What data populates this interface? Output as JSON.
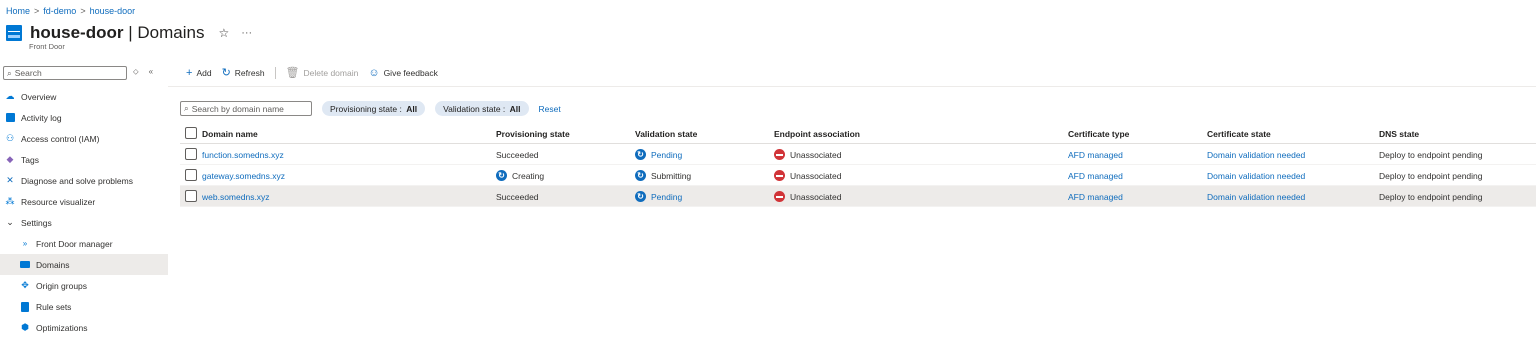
{
  "breadcrumb": [
    "Home",
    "fd-demo",
    "house-door"
  ],
  "header": {
    "resource": "house-door",
    "separator": " | ",
    "blade": "Domains",
    "subtitle": "Front Door"
  },
  "sidebar": {
    "search_placeholder": "Search",
    "items": [
      {
        "label": "Overview",
        "icon": "cloud-icon",
        "color": "#0078d4"
      },
      {
        "label": "Activity log",
        "icon": "log-icon",
        "color": "#0078d4"
      },
      {
        "label": "Access control (IAM)",
        "icon": "people-icon",
        "color": "#0078d4"
      },
      {
        "label": "Tags",
        "icon": "tag-icon",
        "color": "#8764b8"
      },
      {
        "label": "Diagnose and solve problems",
        "icon": "wrench-icon",
        "color": "#0078d4"
      },
      {
        "label": "Resource visualizer",
        "icon": "nodes-icon",
        "color": "#0078d4"
      },
      {
        "label": "Settings",
        "icon": "chevron-down-icon",
        "color": "#323130"
      },
      {
        "label": "Front Door manager",
        "icon": "front-door-icon",
        "color": "#0078d4"
      },
      {
        "label": "Domains",
        "icon": "domains-icon",
        "color": "#0078d4"
      },
      {
        "label": "Origin groups",
        "icon": "origin-icon",
        "color": "#0078d4"
      },
      {
        "label": "Rule sets",
        "icon": "document-icon",
        "color": "#0078d4"
      },
      {
        "label": "Optimizations",
        "icon": "cube-icon",
        "color": "#0078d4"
      }
    ]
  },
  "toolbar": {
    "add": "Add",
    "refresh": "Refresh",
    "delete": "Delete domain",
    "feedback": "Give feedback"
  },
  "filters": {
    "search_placeholder": "Search by domain name",
    "provisioning_label": "Provisioning state : ",
    "provisioning_value": "All",
    "validation_label": "Validation state : ",
    "validation_value": "All",
    "reset": "Reset"
  },
  "table": {
    "columns": [
      "Domain name",
      "Provisioning state",
      "Validation state",
      "Endpoint association",
      "Certificate type",
      "Certificate state",
      "DNS state"
    ],
    "rows": [
      {
        "domain": "function.somedns.xyz",
        "provisioning": "Succeeded",
        "validation": "Pending",
        "endpoint": "Unassociated",
        "cert_type": "AFD managed",
        "cert_state": "Domain validation needed",
        "dns": "Deploy to endpoint pending"
      },
      {
        "domain": "gateway.somedns.xyz",
        "provisioning": "Creating",
        "validation": "Submitting",
        "endpoint": "Unassociated",
        "cert_type": "AFD managed",
        "cert_state": "Domain validation needed",
        "dns": "Deploy to endpoint pending"
      },
      {
        "domain": "web.somedns.xyz",
        "provisioning": "Succeeded",
        "validation": "Pending",
        "endpoint": "Unassociated",
        "cert_type": "AFD managed",
        "cert_state": "Domain validation needed",
        "dns": "Deploy to endpoint pending"
      }
    ]
  }
}
